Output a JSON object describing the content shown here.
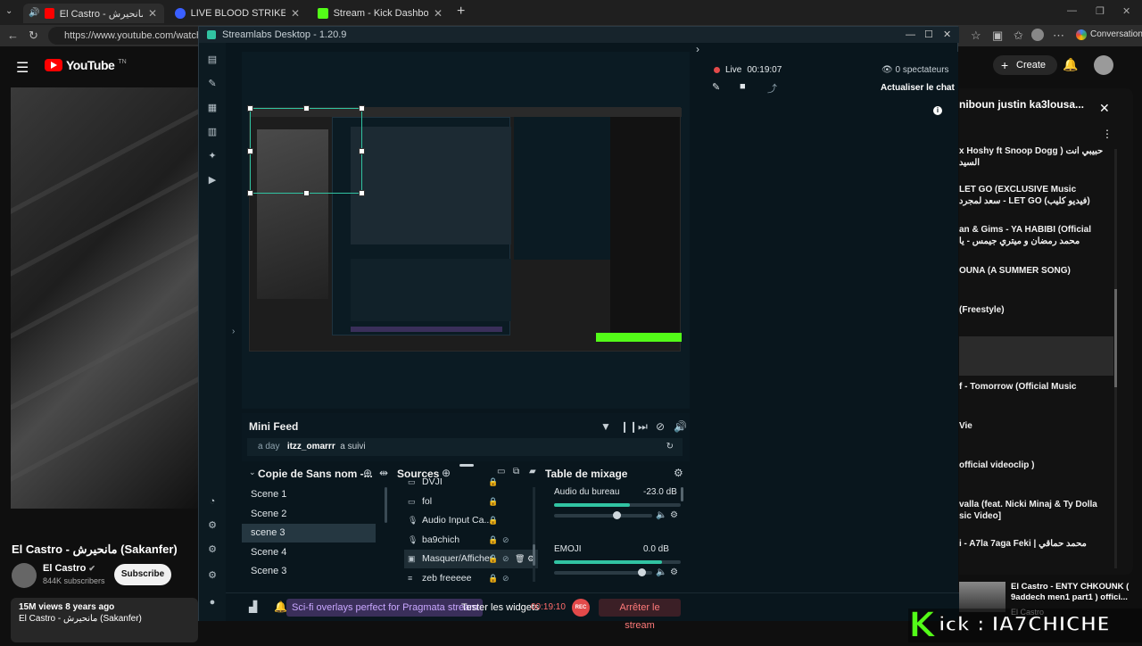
{
  "browser": {
    "tabs": [
      {
        "label": "El Castro - مانحيرش (Sakanfer)",
        "icon": "youtube-favicon"
      },
      {
        "label": "LIVE BLOOD STRIKE - Restre",
        "icon": "restream-favicon"
      },
      {
        "label": "Stream - Kick Dashboard",
        "icon": "kick-favicon"
      }
    ],
    "url": "https://www.youtube.com/watch?v=",
    "conversation_label": "Conversation"
  },
  "youtube": {
    "logo_text": "YouTube",
    "logo_suffix": "TN",
    "create_label": "Create",
    "video_title": "El Castro - مانحيرش (Sakanfer)",
    "channel_name": "El Castro",
    "subscribers": "844K subscribers",
    "subscribe_label": "Subscribe",
    "stats": "15M views  8 years ago",
    "desc_title": "El Castro - مانحيرش (Sakanfer)",
    "playlist_title": "niboun justin ka3lousa...",
    "playlist": [
      {
        "title": "x Hoshy ft Snoop Dogg ) حبيبي انت",
        "sub": "السيد"
      },
      {
        "title": "LET GO (EXCLUSIVE Music",
        "sub": "سعد لمجرد - LET GO (فيديو كليب)"
      },
      {
        "title": "an & Gims - YA HABIBI (Official",
        "sub": "محمد رمضان و ميتري جيمس - يا"
      },
      {
        "title": "OUNA (A SUMMER SONG)",
        "sub": ""
      },
      {
        "title": "(Freestyle)",
        "sub": ""
      },
      {
        "title": "(Sakanfer)",
        "sub": ""
      },
      {
        "title": "f - Tomorrow (Official Music",
        "sub": ""
      },
      {
        "title": "Vie",
        "sub": ""
      },
      {
        "title": "official videoclip )",
        "sub": ""
      },
      {
        "title": "valla (feat. Nicki Minaj & Ty Dolla",
        "sub": "sic Video]"
      },
      {
        "title": "i - A7la 7aga Feki | محمد حماقي",
        "sub": ""
      }
    ],
    "next_title": "El Castro -  ENTY CHKOUNK ( 9addech men1 part1 ) offici...",
    "next_channel": "El Castro"
  },
  "streamlabs": {
    "window_title": "Streamlabs Desktop - 1.20.9",
    "live_label": "Live",
    "live_time": "00:19:07",
    "viewers": "0 spectateurs",
    "refresh_chat": "Actualiser le chat",
    "mini_feed": {
      "title": "Mini Feed",
      "time": "a day",
      "user": "itzz_omarrr",
      "action": "a suivi"
    },
    "scenes": {
      "title": "Copie de Sans nom -...",
      "items": [
        "Scene 1",
        "Scene 2",
        "scene 3",
        "Scene 4",
        "Scene 3"
      ],
      "selected_index": 2
    },
    "sources": {
      "title": "Sources",
      "items": [
        {
          "name": "DVJI",
          "icon": "folder-icon"
        },
        {
          "name": "fol",
          "icon": "folder-icon"
        },
        {
          "name": "Audio Input Ca...",
          "icon": "mic-icon"
        },
        {
          "name": "ba9chich",
          "icon": "mic-icon"
        },
        {
          "name": "Masquer/Afficher",
          "icon": "image-icon"
        },
        {
          "name": "zeb freeeee",
          "icon": "text-icon"
        }
      ]
    },
    "mixer": {
      "title": "Table de mixage",
      "tracks": [
        {
          "name": "Audio du bureau",
          "db": "-23.0 dB",
          "level": 0.6
        },
        {
          "name": "EMOJI",
          "db": "0.0 dB",
          "level": 0.85
        }
      ]
    },
    "footer": {
      "promo": "Sci-fi overlays perfect for Pragmata stream",
      "test_widgets": "Tester les widgets",
      "timer": "00:19:10",
      "rec": "REC",
      "stop_stream": "Arrêter le stream"
    },
    "colors": {
      "accent": "#31c3a2",
      "live": "#e34a4a",
      "stop": "#ff6b6b",
      "promo_bg": "#3a2f5a"
    }
  },
  "overlay": {
    "kick_text": "ick : IA7CHICHE",
    "kick_letter": "K"
  }
}
